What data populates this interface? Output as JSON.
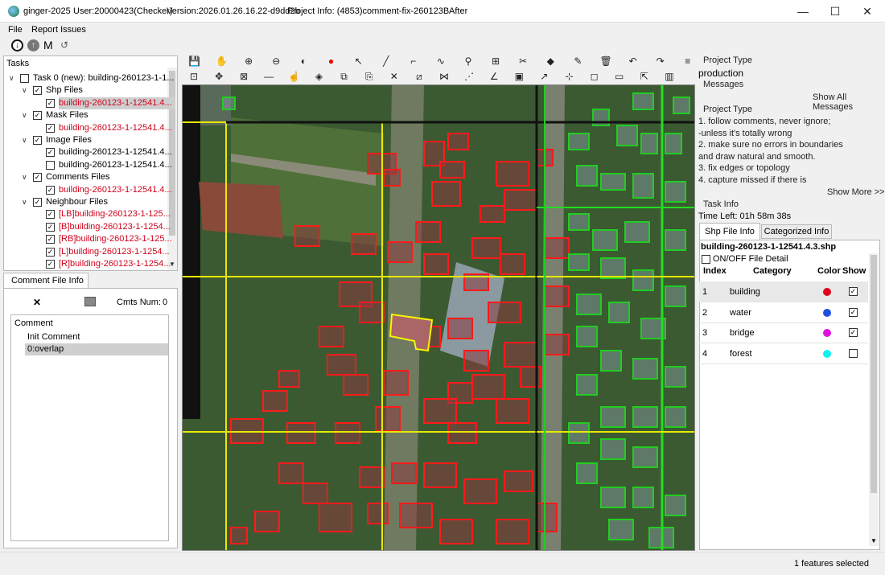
{
  "titlebar": {
    "app": "ginger-2025",
    "user": "User:20000423(Checker)",
    "version": "Version:2026.01.26.16.22-d9dd2b",
    "project_info": "Project Info: (4853)comment-fix-260123B",
    "mode": "After",
    "min_glyph": "—",
    "max_glyph": "☐",
    "close_glyph": "✕"
  },
  "menu": {
    "file": "File",
    "report": "Report Issues"
  },
  "quick_toolbar": {
    "m_label": "M",
    "undo_glyph": "↺"
  },
  "tasks": {
    "header": "Tasks",
    "rows": [
      {
        "label": "Task 0 (new): building-260123-1-1..."
      },
      {
        "label": "Shp Files"
      },
      {
        "label": "building-260123-1-12541.4..."
      },
      {
        "label": "Mask Files"
      },
      {
        "label": "building-260123-1-12541.4..."
      },
      {
        "label": "Image Files"
      },
      {
        "label": "building-260123-1-12541.4..."
      },
      {
        "label": "building-260123-1-12541.4..."
      },
      {
        "label": "Comments Files"
      },
      {
        "label": "building-260123-1-12541.4..."
      },
      {
        "label": "Neighbour Files"
      },
      {
        "label": "[LB]building-260123-1-125..."
      },
      {
        "label": "[B]building-260123-1-1254..."
      },
      {
        "label": "[RB]building-260123-1-125..."
      },
      {
        "label": "[L]building-260123-1-1254..."
      },
      {
        "label": "[R]building-260123-1-1254..."
      }
    ]
  },
  "comment_panel": {
    "tab": "Comment File Info",
    "close_glyph": "✕",
    "cmts_num_label": "Cmts Num:",
    "cmts_num": "0",
    "list_header": "Comment",
    "items": [
      "Init Comment",
      "0:overlap"
    ]
  },
  "right": {
    "project_type_header": "Project Type",
    "project_type_value": "production",
    "messages_header": "Messages",
    "show_all": "Show All Messages",
    "project_type_header2": "Project Type",
    "instructions": [
      "1. follow comments, never ignore;",
      "-unless it's totally wrong",
      "2. make sure no errors in boundaries",
      "and draw natural and smooth.",
      "3. fix edges or topology",
      "4. capture missed if there is"
    ],
    "show_more": "Show More >>",
    "task_info_header": "Task Info",
    "time_left": "Time Left: 01h 58m 38s",
    "tabs": [
      "Shp File Info",
      "Categorized Info"
    ],
    "shp_name": "building-260123-1-12541.4.3.shp",
    "onoff_label": "ON/OFF File Detail",
    "table_headers": [
      "Index",
      "Category",
      "Color",
      "Show"
    ],
    "rows": [
      {
        "index": "1",
        "category": "building",
        "color": "#e0001b",
        "show": true
      },
      {
        "index": "2",
        "category": "water",
        "color": "#1f4fe0",
        "show": true
      },
      {
        "index": "3",
        "category": "bridge",
        "color": "#e010e0",
        "show": true
      },
      {
        "index": "4",
        "category": "forest",
        "color": "#10f0f0",
        "show": false
      }
    ]
  },
  "status": {
    "text": "1 features selected"
  },
  "colors": {
    "building_outline": "#ff1a1a",
    "neighbour_outline": "#22cc22",
    "grid_line": "#f0f000"
  }
}
